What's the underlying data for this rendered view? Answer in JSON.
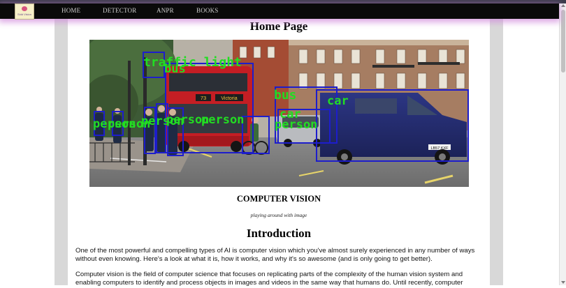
{
  "navbar": {
    "logo_caption": "Sidd Vision",
    "links": [
      "HOME",
      "DETECTOR",
      "ANPR",
      "BOOKS"
    ]
  },
  "page": {
    "title": "Home Page"
  },
  "hero": {
    "detections": [
      "traffic light",
      "bus",
      "bus",
      "car",
      "car",
      "person",
      "person",
      "person",
      "person",
      "person",
      "person"
    ],
    "bus_sign": "Victoria",
    "bus_route": "73",
    "plate_text": "LB57 KXF"
  },
  "section": {
    "title": "COMPUTER VISION",
    "subtitle": "playing around with image"
  },
  "intro": {
    "heading": "Introduction",
    "paragraph1": "One of the most powerful and compelling types of AI is computer vision which you've almost surely experienced in any number of ways without even knowing. Here's a look at what it is, how it works, and why it's so awesome (and is only going to get better).",
    "paragraph2": "Computer vision is the field of computer science that focuses on replicating parts of the complexity of the human vision system and enabling computers to identify and process objects in images and videos in the same way that humans do. Until recently, computer"
  },
  "colors": {
    "navbar_bg": "#0a0a0a",
    "navbar_glow": "#d28cdc",
    "box_color": "#1d1dcc",
    "label_color": "#22dd22"
  }
}
